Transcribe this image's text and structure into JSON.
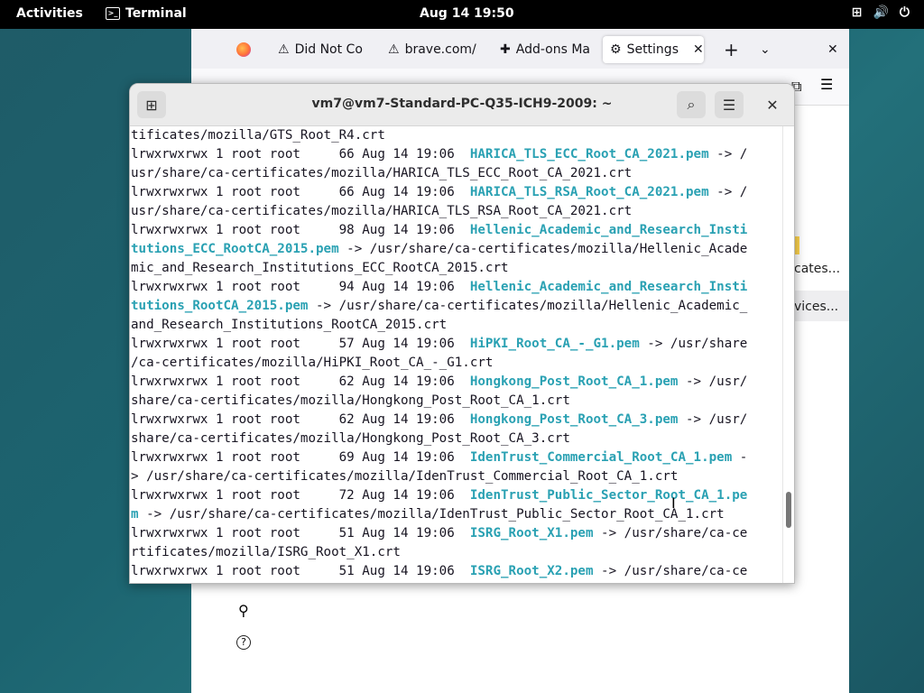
{
  "topbar": {
    "activities": "Activities",
    "app_name": "Terminal",
    "clock": "Aug 14  19:50"
  },
  "browser": {
    "tabs": [
      {
        "label": "Did Not Co",
        "icon": "warning-icon"
      },
      {
        "label": "brave.com/",
        "icon": "warning-icon"
      },
      {
        "label": "Add-ons Ma",
        "icon": "puzzle-icon"
      },
      {
        "label": "Settings",
        "icon": "gear-icon"
      }
    ],
    "side_items": [
      "cates...",
      "vices..."
    ]
  },
  "terminal": {
    "title": "vm7@vm7-Standard-PC-Q35-ICH9-2009: ~",
    "lines": [
      [
        {
          "t": "tificates/mozilla/GTS_Root_R4.crt"
        }
      ],
      [
        {
          "t": "lrwxrwxrwx 1 root root     66 Aug 14 19:06  "
        },
        {
          "t": "HARICA_TLS_ECC_Root_CA_2021.pem",
          "l": 1
        },
        {
          "t": " -> /"
        }
      ],
      [
        {
          "t": "usr/share/ca-certificates/mozilla/HARICA_TLS_ECC_Root_CA_2021.crt"
        }
      ],
      [
        {
          "t": "lrwxrwxrwx 1 root root     66 Aug 14 19:06  "
        },
        {
          "t": "HARICA_TLS_RSA_Root_CA_2021.pem",
          "l": 1
        },
        {
          "t": " -> /"
        }
      ],
      [
        {
          "t": "usr/share/ca-certificates/mozilla/HARICA_TLS_RSA_Root_CA_2021.crt"
        }
      ],
      [
        {
          "t": "lrwxrwxrwx 1 root root     98 Aug 14 19:06  "
        },
        {
          "t": "Hellenic_Academic_and_Research_Insti",
          "l": 1
        }
      ],
      [
        {
          "t": "tutions_ECC_RootCA_2015.pem",
          "l": 1
        },
        {
          "t": " -> /usr/share/ca-certificates/mozilla/Hellenic_Acade"
        }
      ],
      [
        {
          "t": "mic_and_Research_Institutions_ECC_RootCA_2015.crt"
        }
      ],
      [
        {
          "t": "lrwxrwxrwx 1 root root     94 Aug 14 19:06  "
        },
        {
          "t": "Hellenic_Academic_and_Research_Insti",
          "l": 1
        }
      ],
      [
        {
          "t": "tutions_RootCA_2015.pem",
          "l": 1
        },
        {
          "t": " -> /usr/share/ca-certificates/mozilla/Hellenic_Academic_"
        }
      ],
      [
        {
          "t": "and_Research_Institutions_RootCA_2015.crt"
        }
      ],
      [
        {
          "t": "lrwxrwxrwx 1 root root     57 Aug 14 19:06  "
        },
        {
          "t": "HiPKI_Root_CA_-_G1.pem",
          "l": 1
        },
        {
          "t": " -> /usr/share"
        }
      ],
      [
        {
          "t": "/ca-certificates/mozilla/HiPKI_Root_CA_-_G1.crt"
        }
      ],
      [
        {
          "t": "lrwxrwxrwx 1 root root     62 Aug 14 19:06  "
        },
        {
          "t": "Hongkong_Post_Root_CA_1.pem",
          "l": 1
        },
        {
          "t": " -> /usr/"
        }
      ],
      [
        {
          "t": "share/ca-certificates/mozilla/Hongkong_Post_Root_CA_1.crt"
        }
      ],
      [
        {
          "t": "lrwxrwxrwx 1 root root     62 Aug 14 19:06  "
        },
        {
          "t": "Hongkong_Post_Root_CA_3.pem",
          "l": 1
        },
        {
          "t": " -> /usr/"
        }
      ],
      [
        {
          "t": "share/ca-certificates/mozilla/Hongkong_Post_Root_CA_3.crt"
        }
      ],
      [
        {
          "t": "lrwxrwxrwx 1 root root     69 Aug 14 19:06  "
        },
        {
          "t": "IdenTrust_Commercial_Root_CA_1.pem",
          "l": 1
        },
        {
          "t": " -"
        }
      ],
      [
        {
          "t": "> /usr/share/ca-certificates/mozilla/IdenTrust_Commercial_Root_CA_1.crt"
        }
      ],
      [
        {
          "t": "lrwxrwxrwx 1 root root     72 Aug 14 19:06  "
        },
        {
          "t": "IdenTrust_Public_Sector_Root_CA_1.pe",
          "l": 1
        }
      ],
      [
        {
          "t": "m",
          "l": 1
        },
        {
          "t": " -> /usr/share/ca-certificates/mozilla/IdenTrust_Public_Sector_Root_CA_1.crt"
        }
      ],
      [
        {
          "t": "lrwxrwxrwx 1 root root     51 Aug 14 19:06  "
        },
        {
          "t": "ISRG_Root_X1.pem",
          "l": 1
        },
        {
          "t": " -> /usr/share/ca-ce"
        }
      ],
      [
        {
          "t": "rtificates/mozilla/ISRG_Root_X1.crt"
        }
      ],
      [
        {
          "t": "lrwxrwxrwx 1 root root     51 Aug 14 19:06  "
        },
        {
          "t": "ISRG_Root_X2.pem",
          "l": 1
        },
        {
          "t": " -> /usr/share/ca-ce"
        }
      ]
    ]
  }
}
